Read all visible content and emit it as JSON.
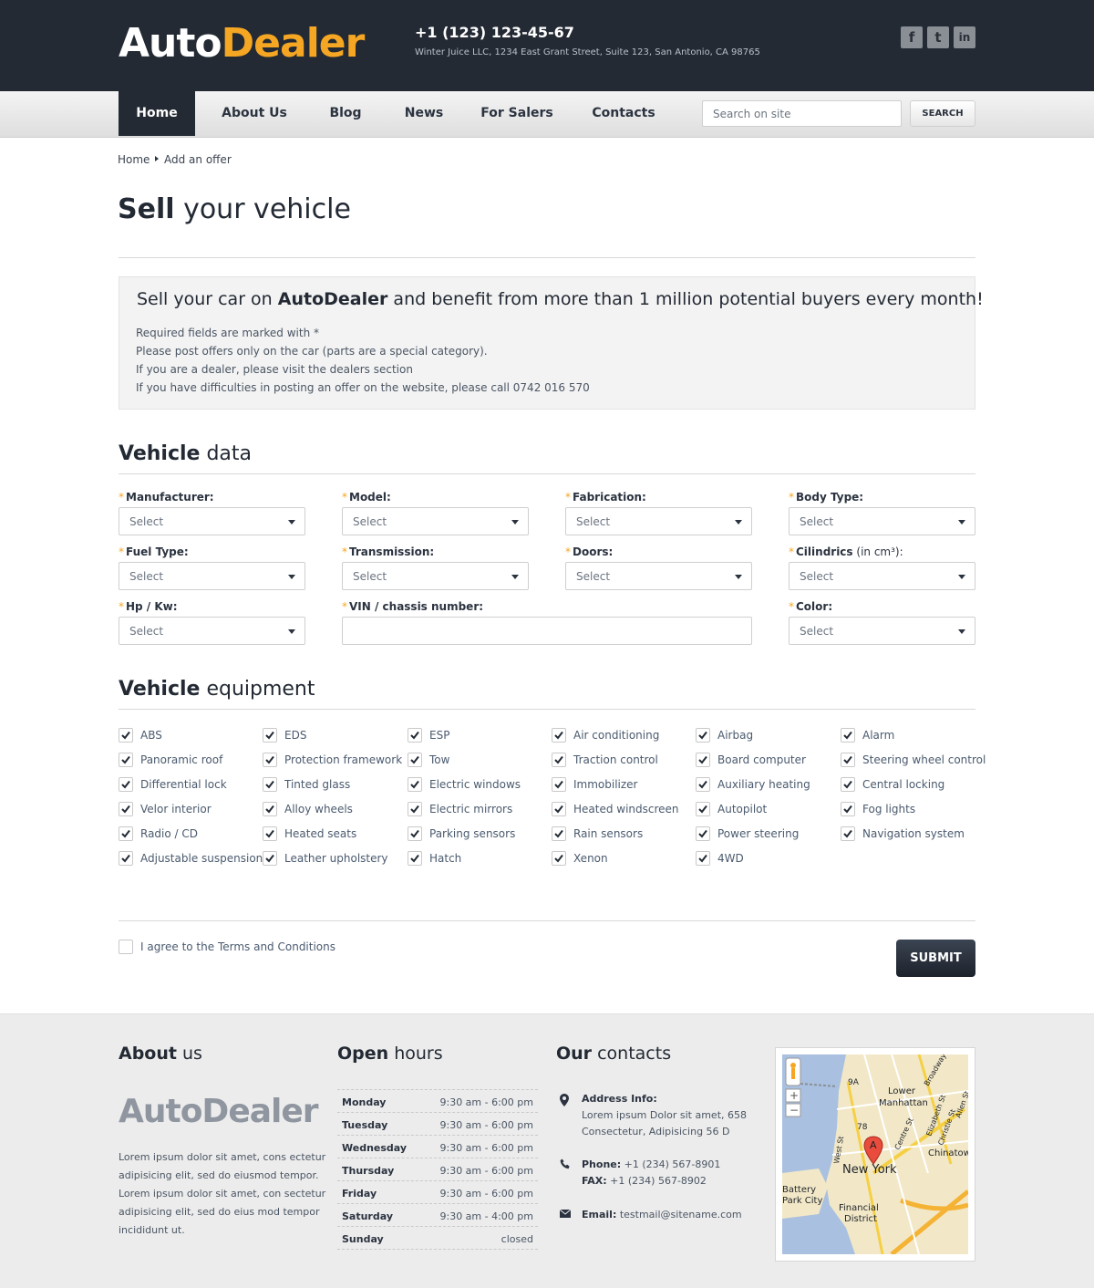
{
  "header": {
    "logo_first": "Auto",
    "logo_second": "Dealer",
    "phone": "+1 (123) 123-45-67",
    "address": "Winter Juice LLC, 1234 East Grant Street, Suite 123, San Antonio, CA 98765",
    "social": [
      {
        "icon": "facebook-icon",
        "glyph": "f"
      },
      {
        "icon": "twitter-icon",
        "glyph": "t"
      },
      {
        "icon": "linkedin-icon",
        "glyph": "in"
      }
    ]
  },
  "nav": {
    "items": [
      "Home",
      "About Us",
      "Blog",
      "News",
      "For Salers",
      "Contacts"
    ],
    "active": "Home",
    "search_placeholder": "Search on site",
    "search_button": "SEARCH"
  },
  "breadcrumb": [
    "Home",
    "Add an offer"
  ],
  "page_title": {
    "bold": "Sell",
    "rest": " your vehicle"
  },
  "info": {
    "headline_pre": "Sell your car on ",
    "headline_brand": "AutoDealer",
    "headline_post": " and benefit from more than 1 million potential buyers every month!",
    "lines": [
      "Required fields are marked with *",
      "Please post offers only on the car (parts are a special category).",
      "If you are a dealer, please visit the dealers section",
      "If you have difficulties in posting an offer on the website, please call 0742 016 570"
    ]
  },
  "vehicle_data": {
    "title_bold": "Vehicle",
    "title_rest": " data",
    "required_mark": "*",
    "select_placeholder": "Select",
    "fields": [
      {
        "label": "Manufacturer:",
        "value": "Select"
      },
      {
        "label": "Model:",
        "value": "Select"
      },
      {
        "label": "Fabrication:",
        "value": "Select"
      },
      {
        "label": "Body Type:",
        "value": "Select"
      },
      {
        "label": "Fuel Type:",
        "value": "Select"
      },
      {
        "label": "Transmission:",
        "value": "Select"
      },
      {
        "label": "Doors:",
        "value": "Select"
      },
      {
        "label": "Cilindrics",
        "suffix": " (in cm³):",
        "value": "Select"
      },
      {
        "label": "Hp / Kw:",
        "value": "Select"
      },
      {
        "label": "VIN / chassis number:",
        "value": ""
      },
      {
        "label": "Color:",
        "value": "Select"
      }
    ]
  },
  "equipment": {
    "title_bold": "Vehicle",
    "title_rest": " equipment",
    "columns": [
      [
        "ABS",
        "Panoramic roof",
        "Differential lock",
        "Velor interior",
        "Radio / CD",
        "Adjustable suspension"
      ],
      [
        "EDS",
        "Protection framework",
        "Tinted glass",
        "Alloy wheels",
        "Heated seats",
        "Leather upholstery"
      ],
      [
        "ESP",
        "Tow",
        "Electric windows",
        "Electric mirrors",
        "Parking sensors",
        "Hatch"
      ],
      [
        "Air conditioning",
        "Traction control",
        "Immobilizer",
        "Heated windscreen",
        "Rain sensors",
        "Xenon"
      ],
      [
        "Airbag",
        "Board computer",
        "Auxiliary heating",
        "Autopilot",
        "Power steering",
        "4WD"
      ],
      [
        "Alarm",
        "Steering wheel control",
        "Central locking",
        "Fog lights",
        "Navigation system"
      ]
    ],
    "checked": true
  },
  "agreement": {
    "label": "I agree to the Terms and Conditions",
    "checked": false
  },
  "submit": "SUBMIT",
  "footer": {
    "about_title_bold": "About",
    "about_title_rest": " us",
    "about_logo": "AutoDealer",
    "about_lines": [
      "Lorem ipsum dolor sit amet, cons ectetur",
      "adipisicing elit, sed do eiusmod tempor.",
      "Lorem ipsum dolor sit amet, con sectetur",
      "adipisicing elit, sed do eius  mod tempor",
      "incididunt ut."
    ],
    "hours_title_bold": "Open",
    "hours_title_rest": " hours",
    "hours": [
      {
        "day": "Monday",
        "time": "9:30 am - 6:00 pm"
      },
      {
        "day": "Tuesday",
        "time": "9:30 am - 6:00 pm"
      },
      {
        "day": "Wednesday",
        "time": "9:30 am - 6:00 pm"
      },
      {
        "day": "Thursday",
        "time": "9:30 am - 6:00 pm"
      },
      {
        "day": "Friday",
        "time": "9:30 am - 6:00 pm"
      },
      {
        "day": "Saturday",
        "time": "9:30 am - 4:00 pm"
      },
      {
        "day": "Sunday",
        "time": "closed"
      }
    ],
    "contacts_title_bold": "Our",
    "contacts_title_rest": " contacts",
    "address_label": "Address Info:",
    "address_lines": [
      "Lorem ipsum Dolor sit amet, 658",
      "Consectetur, Adipisicing 56 D"
    ],
    "phone_label": "Phone:",
    "phone": "+1 (234) 567-8901",
    "fax_label": "FAX:",
    "fax": "+1 (234) 567-8902",
    "email_label": "Email:",
    "email": "testmail@sitename.com",
    "map_labels": [
      "Lower",
      "Manhattan",
      "New York",
      "Chinatown",
      "Battery",
      "Park City",
      "Financial",
      "District",
      "Broadway",
      "Elizabeth St",
      "Christie St",
      "Allen St",
      "Centre St",
      "West St",
      "9A",
      "78",
      "A"
    ]
  }
}
